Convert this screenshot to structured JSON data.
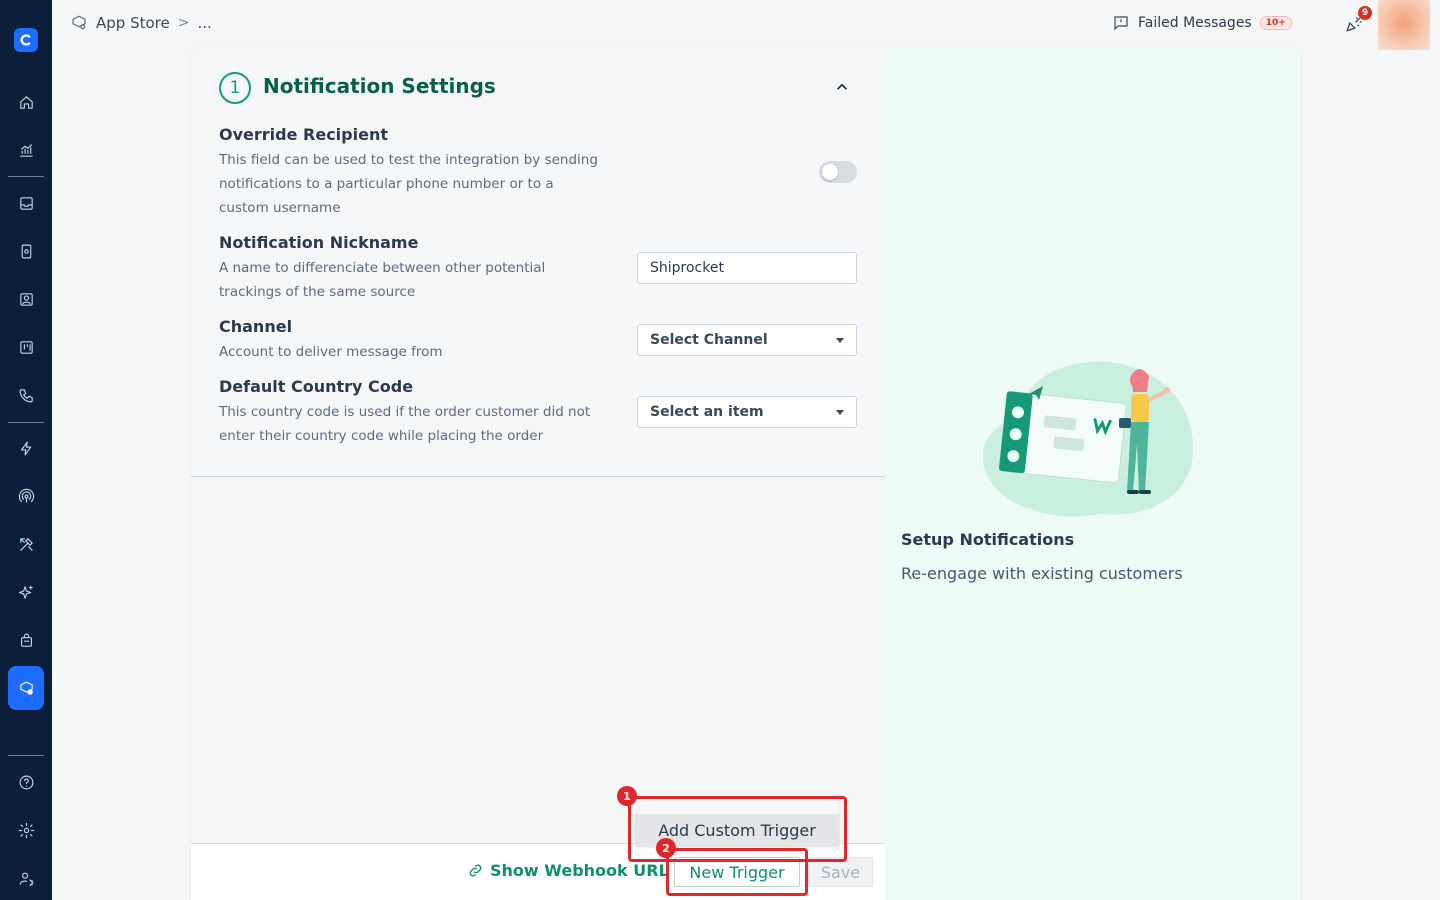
{
  "breadcrumb": {
    "root": "App Store",
    "separator": ">",
    "current": "..."
  },
  "topbar": {
    "failed_label": "Failed Messages",
    "failed_count": "10+",
    "notification_count": "9"
  },
  "sidebar": {
    "icons": [
      "home-icon",
      "analytics-icon",
      "inbox-icon",
      "catalog-icon",
      "contacts-icon",
      "board-icon",
      "phone-icon",
      "automation-icon",
      "broadcast-icon",
      "tools-icon",
      "ai-sparkle-icon",
      "bag-icon",
      "app-store-icon",
      "help-icon",
      "settings-icon",
      "team-icon"
    ],
    "active": "app-store-icon"
  },
  "section": {
    "step": "1",
    "title": "Notification Settings"
  },
  "fields": {
    "override": {
      "label": "Override Recipient",
      "desc_lines": [
        "This field can be used to test the integration by sending",
        "notifications to a particular phone number or to a",
        "custom username"
      ],
      "enabled": false
    },
    "nickname": {
      "label": "Notification Nickname",
      "desc_lines": [
        "A name to differenciate between other potential",
        "trackings of the same source"
      ],
      "value": "Shiprocket"
    },
    "channel": {
      "label": "Channel",
      "desc_lines": [
        "Account to deliver message from"
      ],
      "selected": "Select Channel"
    },
    "country": {
      "label": "Default Country Code",
      "desc_lines": [
        "This country code is used if the order customer did not",
        "enter their country code while placing the order"
      ],
      "selected": "Select an item"
    }
  },
  "footer": {
    "webhook_label": "Show Webhook URL",
    "custom_trigger_label": "Add Custom Trigger",
    "new_trigger_label": "New Trigger",
    "save_label": "Save"
  },
  "annotations": {
    "one": "1",
    "two": "2"
  },
  "promo": {
    "title": "Setup Notifications",
    "subtitle": "Re-engage with existing customers"
  },
  "colors": {
    "sidebar": "#0b1f3a",
    "accent_blue": "#1e6cff",
    "brand_green": "#0d9f7b",
    "highlight_red": "#e0262b"
  }
}
